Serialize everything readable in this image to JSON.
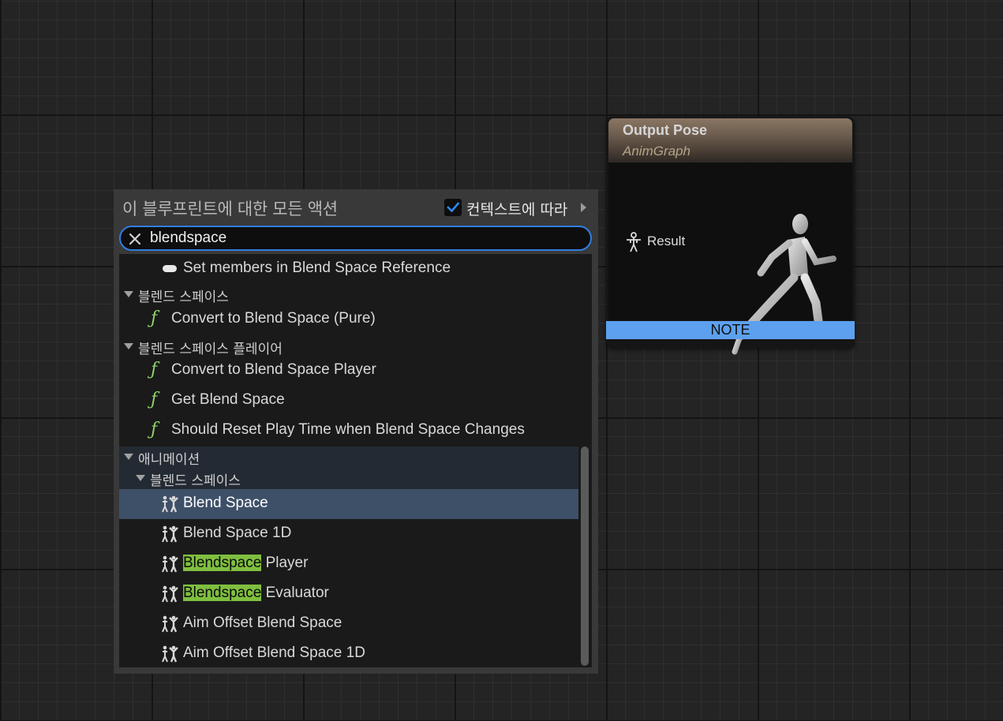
{
  "menu": {
    "title": "이 블루프린트에 대한 모든 액션",
    "context_label": "컨텍스트에 따라",
    "context_checked": true,
    "search": {
      "value": "blendspace"
    },
    "rows": [
      {
        "kind": "member",
        "label": "Set members in Blend Space Reference"
      },
      {
        "kind": "category",
        "label": "블렌드 스페이스"
      },
      {
        "kind": "function",
        "label": "Convert to Blend Space (Pure)"
      },
      {
        "kind": "category",
        "label": "블렌드 스페이스 플레이어"
      },
      {
        "kind": "function",
        "label": "Convert to Blend Space Player"
      },
      {
        "kind": "function",
        "label": "Get Blend Space"
      },
      {
        "kind": "function",
        "label": "Should Reset Play Time when Blend Space Changes"
      },
      {
        "kind": "category",
        "label": "애니메이션"
      },
      {
        "kind": "category",
        "label": "블렌드 스페이스"
      },
      {
        "kind": "anim-node",
        "label": "Blend Space",
        "selected": true
      },
      {
        "kind": "anim-node",
        "label": "Blend Space 1D"
      },
      {
        "kind": "anim-node",
        "highlight": "Blendspace",
        "label": " Player"
      },
      {
        "kind": "anim-node",
        "highlight": "Blendspace",
        "label": " Evaluator"
      },
      {
        "kind": "anim-node",
        "label": "Aim Offset Blend Space"
      },
      {
        "kind": "anim-node",
        "label": "Aim Offset Blend Space 1D"
      }
    ]
  },
  "node": {
    "title": "Output Pose",
    "subtitle": "AnimGraph",
    "pin_label": "Result",
    "note_label": "NOTE"
  },
  "colors": {
    "accent_blue": "#2f7fe0",
    "note_blue": "#5da0ef",
    "match_highlight": "#7fbf3f",
    "selected_row": "#3e5068",
    "function_icon": "#8fd36a"
  }
}
